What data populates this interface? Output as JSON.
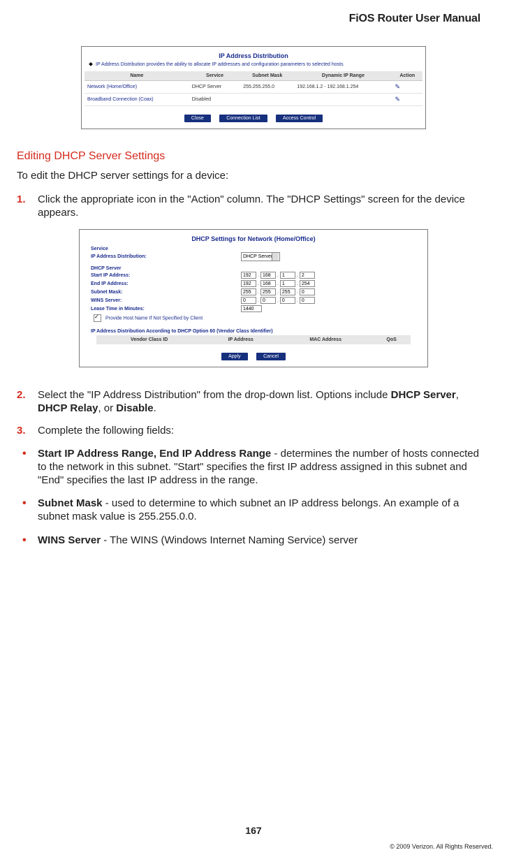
{
  "header": {
    "title": "FiOS Router User Manual"
  },
  "panel1": {
    "title": "IP Address Distribution",
    "desc": "IP Address Distribution provides the ability to allocate IP addresses and configuration parameters to selected hosts",
    "cols": {
      "c1": "Name",
      "c2": "Service",
      "c3": "Subnet Mask",
      "c4": "Dynamic IP Range",
      "c5": "Action"
    },
    "rows": [
      {
        "name": "Network (Home/Office)",
        "service": "DHCP Server",
        "mask": "255.255.255.0",
        "range": "192.168.1.2 - 192.168.1.254"
      },
      {
        "name": "Broadband Connection (Coax)",
        "service": "Disabled",
        "mask": "",
        "range": ""
      }
    ],
    "buttons": {
      "close": "Close",
      "conn": "Connection List",
      "access": "Access Control"
    }
  },
  "section": {
    "heading": "Editing DHCP Server Settings"
  },
  "intro": "To edit the DHCP server settings for a device:",
  "step1": "Click the appropriate icon in the \"Action\" column. The \"DHCP Settings\" screen for the device appears.",
  "panel2": {
    "title": "DHCP Settings for Network (Home/Office)",
    "svc_section": "Service",
    "dist_label": "IP Address Distribution:",
    "dist_value": "DHCP Server",
    "dhcp_header": "DHCP Server",
    "start_label": "Start IP Address:",
    "start_ip": [
      "192",
      "168",
      "1",
      "2"
    ],
    "end_label": "End IP Address:",
    "end_ip": [
      "192",
      "168",
      "1",
      "254"
    ],
    "mask_label": "Subnet Mask:",
    "mask": [
      "255",
      "255",
      "255",
      "0"
    ],
    "wins_label": "WINS Server:",
    "wins": [
      "0",
      "0",
      "0",
      "0"
    ],
    "lease_label": "Lease Time in Minutes:",
    "lease": "1440",
    "checkbox_label": "Provide Host Name If Not Specified by Client",
    "opt60_header": "IP Address Distribution According to DHCP Option 60 (Vendor Class Identifier)",
    "opt60_cols": {
      "c1": "Vendor Class ID",
      "c2": "IP Address",
      "c3": "MAC Address",
      "c4": "QoS"
    },
    "buttons": {
      "apply": "Apply",
      "cancel": "Cancel"
    }
  },
  "step2": {
    "pre": "Select the \"IP Address Distribution\" from the drop-down list. Options include ",
    "b1": "DHCP Server",
    "sep1": ", ",
    "b2": "DHCP Relay",
    "sep2": ", or ",
    "b3": "Disable",
    "post": "."
  },
  "step3": "Complete the following fields:",
  "bul1": {
    "b": "Start IP Address Range, End IP Address Range",
    "rest": " - determines the number of hosts connected to the network in this subnet. \"Start\" specifies the first IP address assigned in this subnet and \"End\" specifies the last IP address in the range."
  },
  "bul2": {
    "b": "Subnet Mask",
    "rest": " - used to determine to which subnet an IP address belongs. An example of a subnet mask value is 255.255.0.0."
  },
  "bul3": {
    "b": "WINS  Server",
    "rest": " - The WINS (Windows Internet Naming Service) server"
  },
  "footer": {
    "page": "167",
    "copy": "© 2009 Verizon. All Rights Reserved."
  }
}
